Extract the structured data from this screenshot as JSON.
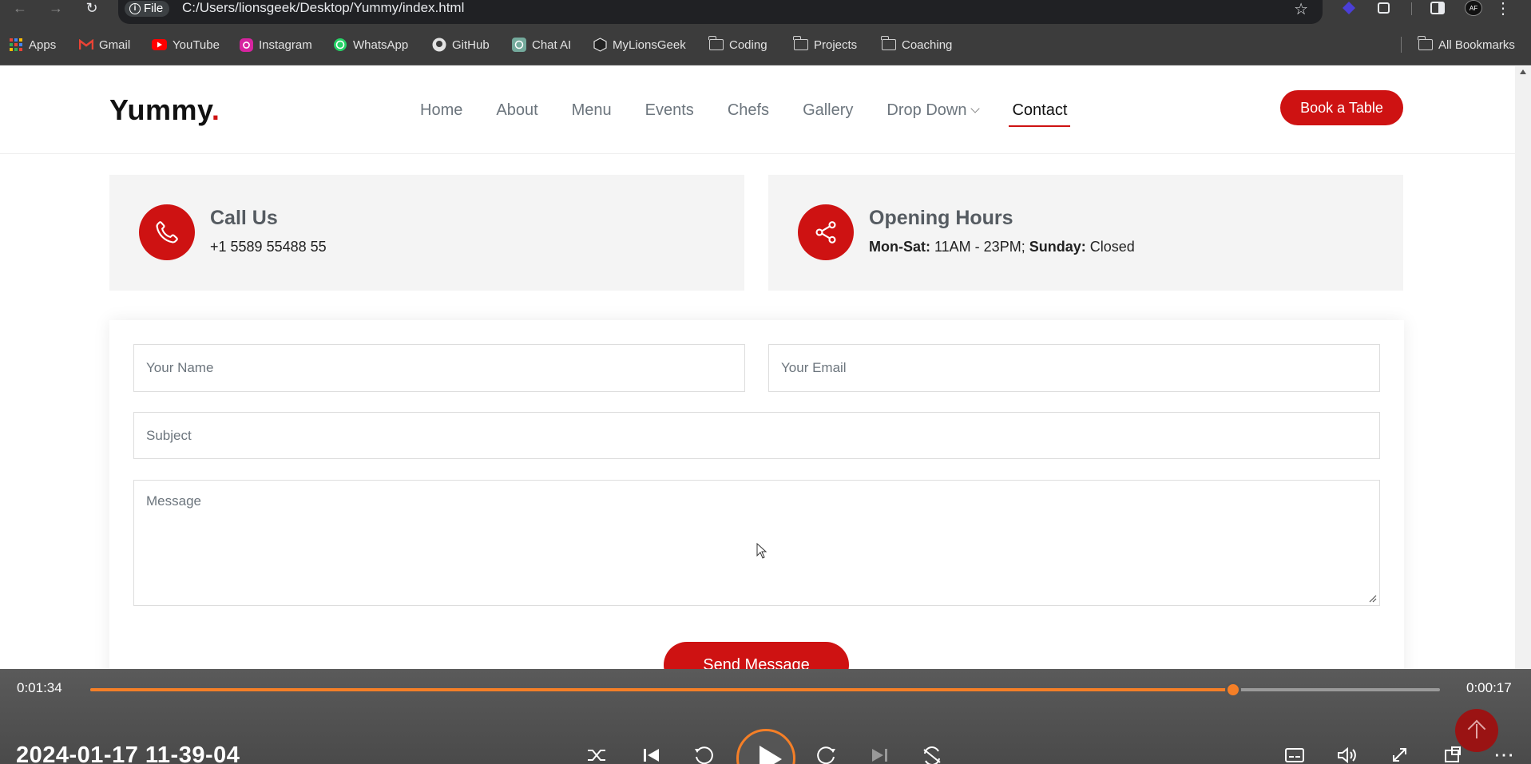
{
  "browser": {
    "file_chip": "File",
    "url": "C:/Users/lionsgeek/Desktop/Yummy/index.html",
    "bookmarks": [
      {
        "label": "Apps",
        "icon": "apps-grid-icon"
      },
      {
        "label": "Gmail",
        "icon": "gmail-icon"
      },
      {
        "label": "YouTube",
        "icon": "youtube-icon"
      },
      {
        "label": "Instagram",
        "icon": "instagram-icon"
      },
      {
        "label": "WhatsApp",
        "icon": "whatsapp-icon"
      },
      {
        "label": "GitHub",
        "icon": "github-icon"
      },
      {
        "label": "Chat AI",
        "icon": "chatgpt-icon"
      },
      {
        "label": "MyLionsGeek",
        "icon": "lionsgeek-icon"
      },
      {
        "label": "Coding",
        "icon": "folder-icon"
      },
      {
        "label": "Projects",
        "icon": "folder-icon"
      },
      {
        "label": "Coaching",
        "icon": "folder-icon"
      }
    ],
    "all_bookmarks": "All Bookmarks"
  },
  "site": {
    "logo": "Yummy",
    "logo_dot": ".",
    "nav": [
      "Home",
      "About",
      "Menu",
      "Events",
      "Chefs",
      "Gallery",
      "Drop Down",
      "Contact"
    ],
    "active_nav": "Contact",
    "book_button": "Book a Table",
    "accent": "#ce1212"
  },
  "contact": {
    "call": {
      "title": "Call Us",
      "value": "+1 5589 55488 55"
    },
    "hours": {
      "title": "Opening Hours",
      "days_label": "Mon-Sat:",
      "days_value": " 11AM - 23PM; ",
      "sunday_label": "Sunday:",
      "sunday_value": " Closed"
    },
    "form": {
      "name_placeholder": "Your Name",
      "email_placeholder": "Your Email",
      "subject_placeholder": "Subject",
      "message_placeholder": "Message",
      "send_button": "Send Message"
    }
  },
  "player": {
    "elapsed": "0:01:34",
    "remaining": "0:00:17",
    "progress": 0.847,
    "date": "2024-01-17 11-39-04",
    "accent": "#f57f27"
  }
}
